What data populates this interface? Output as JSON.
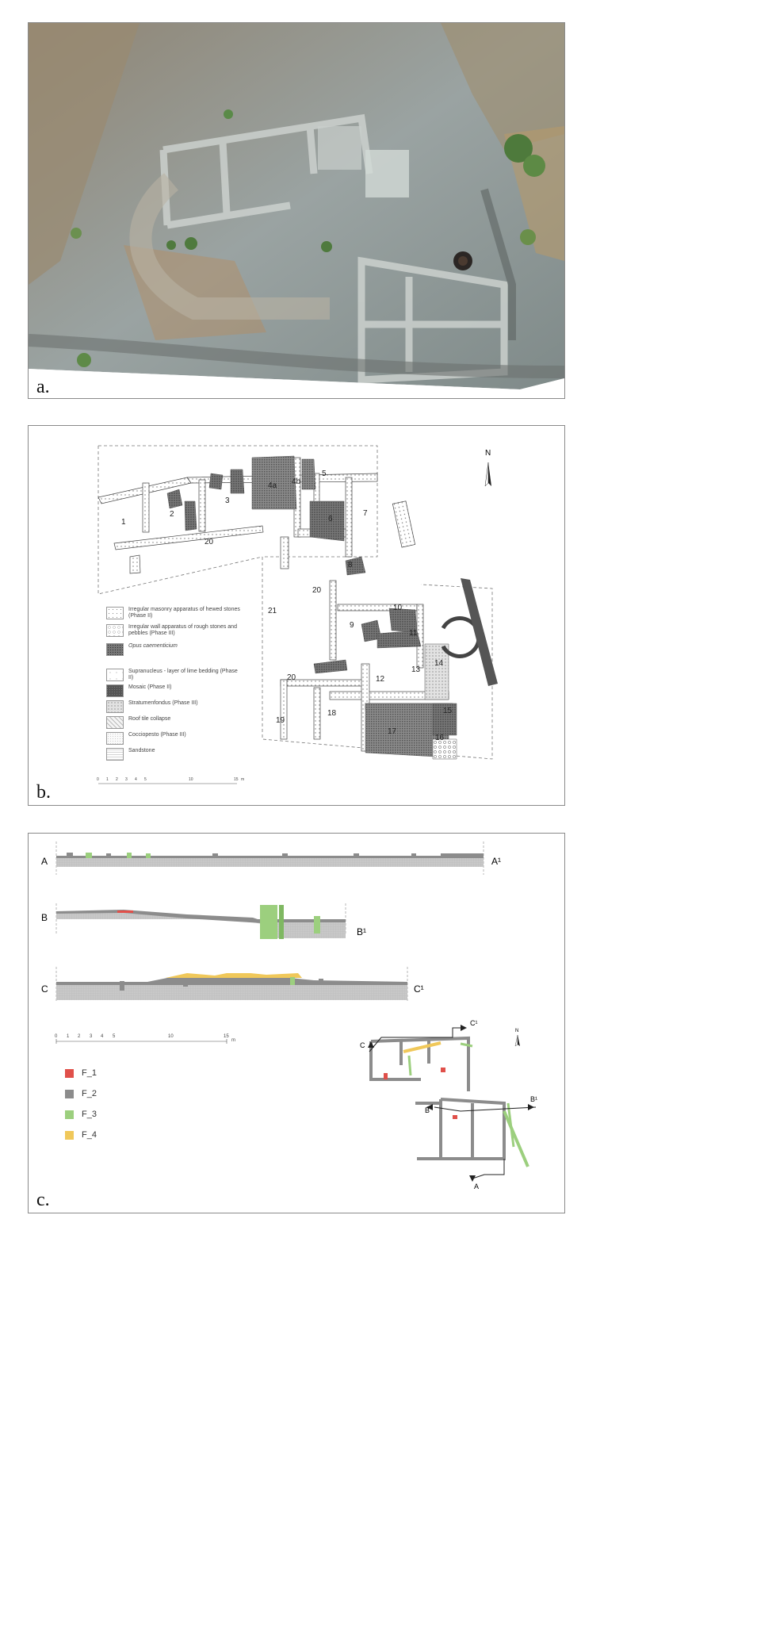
{
  "panels": {
    "a": {
      "label": "a."
    },
    "b": {
      "label": "b."
    },
    "c": {
      "label": "c."
    }
  },
  "plan": {
    "north": "N",
    "rooms": [
      {
        "id": "1",
        "label": "1"
      },
      {
        "id": "2",
        "label": "2"
      },
      {
        "id": "3",
        "label": "3"
      },
      {
        "id": "4a",
        "label": "4a"
      },
      {
        "id": "4b",
        "label": "4b"
      },
      {
        "id": "5",
        "label": "5"
      },
      {
        "id": "6",
        "label": "6"
      },
      {
        "id": "7",
        "label": "7"
      },
      {
        "id": "8",
        "label": "8"
      },
      {
        "id": "9",
        "label": "9"
      },
      {
        "id": "10",
        "label": "10"
      },
      {
        "id": "11",
        "label": "11"
      },
      {
        "id": "12",
        "label": "12"
      },
      {
        "id": "13",
        "label": "13"
      },
      {
        "id": "14",
        "label": "14"
      },
      {
        "id": "15",
        "label": "15"
      },
      {
        "id": "16",
        "label": "16"
      },
      {
        "id": "17",
        "label": "17"
      },
      {
        "id": "18",
        "label": "18"
      },
      {
        "id": "19",
        "label": "19"
      },
      {
        "id": "20a",
        "label": "20"
      },
      {
        "id": "20b",
        "label": "20"
      },
      {
        "id": "20c",
        "label": "20"
      },
      {
        "id": "21",
        "label": "21"
      }
    ],
    "legend": [
      {
        "text": "Irregular masonry apparatus of hewed stones (Phase II)",
        "pattern": "dots"
      },
      {
        "text": "Irregular wall apparatus of rough stones and pebbles (Phase III)",
        "pattern": "pebbles"
      },
      {
        "text": "Opus caementicium",
        "pattern": "dense"
      },
      {
        "text": "Supranucleus - layer of lime bedding (Phase II)",
        "pattern": "sparse"
      },
      {
        "text": "Mosaic (Phase II)",
        "pattern": "mosaic"
      },
      {
        "text": "Stratumenfondus (Phase III)",
        "pattern": "fine"
      },
      {
        "text": "Roof tile collapse",
        "pattern": "tile"
      },
      {
        "text": "Cocciopesto (Phase III)",
        "pattern": "light"
      },
      {
        "text": "Sandstone",
        "pattern": "lines"
      }
    ],
    "scale": {
      "ticks": [
        "0",
        "1",
        "2",
        "3",
        "4",
        "5",
        "10",
        "15"
      ],
      "unit": "m"
    }
  },
  "sections": {
    "A": {
      "start": "A",
      "end": "A¹"
    },
    "B": {
      "start": "B",
      "end": "B¹"
    },
    "C": {
      "start": "C",
      "end": "C¹"
    },
    "scale": {
      "ticks": [
        "0",
        "1",
        "2",
        "3",
        "4",
        "5",
        "10",
        "15"
      ],
      "unit": "m"
    },
    "legend": [
      {
        "label": "F_1",
        "color": "#e0504a"
      },
      {
        "label": "F_2",
        "color": "#8c8c8c"
      },
      {
        "label": "F_3",
        "color": "#9ccf7e"
      },
      {
        "label": "F_4",
        "color": "#f0c85a"
      }
    ],
    "keymap_labels": {
      "c": "C",
      "c1": "C¹",
      "b": "B",
      "b1": "B¹",
      "a": "A",
      "north": "N"
    }
  }
}
